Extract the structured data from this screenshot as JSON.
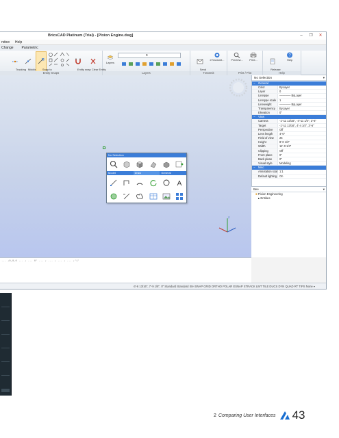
{
  "window": {
    "title": "BricsCAD Platinum (Trial) - [Pixion Engine.dwg]",
    "controls": [
      "–",
      "❐",
      "✕"
    ]
  },
  "menubar": {
    "items": [
      "ndow",
      "Help"
    ]
  },
  "tabs": {
    "items": [
      "Change",
      "Parametric"
    ]
  },
  "ribbon": {
    "tracking_label": "Tracking\npoints",
    "middle_label": "Middle of\n2 Points",
    "snap_label": "Snap to\nEndpoint",
    "entity_snap_label": "Entity snap\ntoggle",
    "clear_label": "Clear Entity\nSnaps",
    "layers_label": "Layers",
    "layer_value": "0",
    "send_mail_label": "Send\nMail...",
    "etransmit_label": "eTransmit...",
    "preview_label": "Preview...",
    "print_label": "Print...",
    "release_label": "Release\nnotes...",
    "help_label": "Help",
    "groups": {
      "entity_snaps": "Entity Snaps",
      "layers": "Layers",
      "transmit": "Transmit",
      "print_plot": "Print / Plot",
      "help": "Help"
    }
  },
  "quad": {
    "header": "No Selection",
    "tabs": [
      "Model",
      "Draw",
      "General"
    ]
  },
  "properties": {
    "selection": "No Selection",
    "sections": [
      {
        "name": "General",
        "rows": [
          {
            "k": "Color",
            "v": "ByLayer"
          },
          {
            "k": "Layer",
            "v": "0"
          },
          {
            "k": "Linetype",
            "v": "———— ByLayer"
          },
          {
            "k": "Linetype scale",
            "v": "1"
          },
          {
            "k": "Lineweight",
            "v": "———— ByLayer"
          },
          {
            "k": "Transparency",
            "v": "ByLayer"
          },
          {
            "k": "Elevation",
            "v": "0\""
          }
        ]
      },
      {
        "name": "View",
        "rows": [
          {
            "k": "Camera",
            "v": "-1'-11 13/16\", -4'-11 1/4\", 3'-6\""
          },
          {
            "k": "Target",
            "v": "-1'-11 13/16\", 4'-4 1/4\", 3'-6\""
          },
          {
            "k": "Perspective",
            "v": "Off"
          },
          {
            "k": "Lens length",
            "v": "4'-0\""
          },
          {
            "k": "Field of view",
            "v": "26"
          },
          {
            "k": "Height",
            "v": "8'-0 1/2\""
          },
          {
            "k": "Width",
            "v": "14'-0 1/4\""
          },
          {
            "k": "Clipping",
            "v": "Off"
          },
          {
            "k": "Front plane",
            "v": "0\""
          },
          {
            "k": "Back plane",
            "v": "0\""
          },
          {
            "k": "Visual style",
            "v": "Modeling"
          }
        ]
      },
      {
        "name": "Misc",
        "rows": [
          {
            "k": "Annotation scale",
            "v": "1:1"
          },
          {
            "k": "Default lighting",
            "v": "On"
          }
        ]
      }
    ]
  },
  "explorer": {
    "header": "Bee",
    "items": [
      "Pixion Engineering",
      "Entities"
    ]
  },
  "command": {
    "text": "... ;0,0,0 ... ; ... 0' ... ; ... ; ... ; ... ;'1'"
  },
  "status": {
    "text": "-3'-6 13/16\", 7'-9 1/8\", 0\"   Standard   Standard   ISH   SNAP   GRID   ORTHO   POLAR   ESNAP   STRACK   LWT   TILE   DUCS   DYN   QUAD   RT   TIPS   None  ▾"
  },
  "footer": {
    "chapter": "2",
    "caption": "Comparing User Interfaces",
    "page": "43"
  },
  "colors": {
    "accent": "#3b7dd8",
    "canvas_top": "#dfe6f0",
    "canvas_bottom": "#b8c6ee",
    "dark_panel": "#1f2b33",
    "logo_blue": "#1a6fd1"
  }
}
